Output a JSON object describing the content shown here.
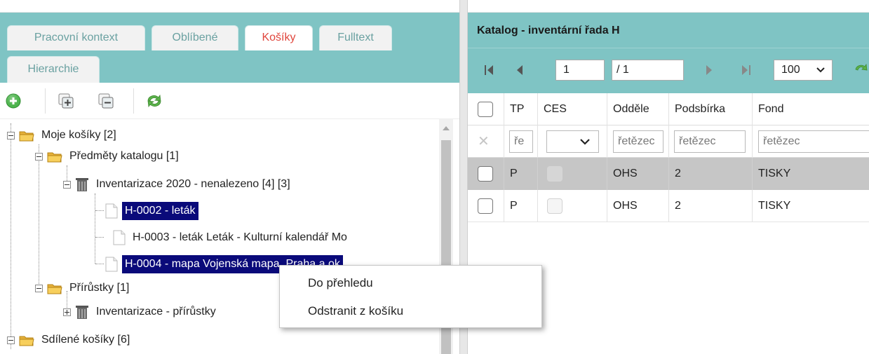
{
  "left_panel": {
    "tabs": [
      {
        "label": "Pracovní kontext",
        "active": false
      },
      {
        "label": "Oblíbené",
        "active": false
      },
      {
        "label": "Košíky",
        "active": true
      },
      {
        "label": "Fulltext",
        "active": false
      },
      {
        "label": "Hierarchie",
        "active": false
      }
    ],
    "toolbar": {
      "icons": [
        "add-circle-icon",
        "expand-all-icon",
        "collapse-all-icon",
        "refresh-icon"
      ]
    },
    "tree": [
      {
        "label": "Moje košíky [2]",
        "icon": "folder-icon",
        "state": "expanded"
      },
      {
        "label": "Předměty katalogu [1]",
        "icon": "folder-icon",
        "state": "expanded"
      },
      {
        "label": "Inventarizace 2020 - nenalezeno [4] [3]",
        "icon": "trash-bin-icon",
        "state": "expanded"
      },
      {
        "label": "H-0002 - leták",
        "icon": "document-icon",
        "selected": true
      },
      {
        "label": "H-0003 - leták Leták - Kulturní kalendář Mo",
        "icon": "document-icon",
        "selected": false
      },
      {
        "label": "H-0004 - mapa Vojenská mapa, Praha a ok",
        "icon": "document-icon",
        "selected": true
      },
      {
        "label": "Přírůstky [1]",
        "icon": "folder-icon",
        "state": "expanded"
      },
      {
        "label": "Inventarizace - přírůstky",
        "icon": "trash-bin-icon",
        "state": "collapsed"
      },
      {
        "label": "Sdílené košíky [6]",
        "icon": "folder-icon",
        "state": "expanded"
      }
    ]
  },
  "context_menu": {
    "items": [
      "Do přehledu",
      "Odstranit z košíku"
    ]
  },
  "right_panel": {
    "title": "Katalog - inventární řada H",
    "pager": {
      "page": "1",
      "page_total": "/ 1",
      "page_size": "100"
    },
    "columns": [
      "TP",
      "CES",
      "Oddělení",
      "Podsbírka",
      "Fond"
    ],
    "column_labels_visible": [
      "TP",
      "CES",
      "Odděle",
      "Podsbírka",
      "Fond"
    ],
    "filters": {
      "tp": "ře",
      "placeholder": "řetězec"
    },
    "rows": [
      {
        "tp": "P",
        "oddeleni": "OHS",
        "podsbirka": "2",
        "fond": "TISKY",
        "highlighted": true
      },
      {
        "tp": "P",
        "oddeleni": "OHS",
        "podsbirka": "2",
        "fond": "TISKY",
        "highlighted": false
      }
    ]
  },
  "colors": {
    "panel_teal": "#7fc4c4",
    "active_tab_text": "#e0463d",
    "tab_text": "#6aa1a1",
    "selection": "#0a0a7a",
    "highlight_row": "#c6c6c6"
  }
}
